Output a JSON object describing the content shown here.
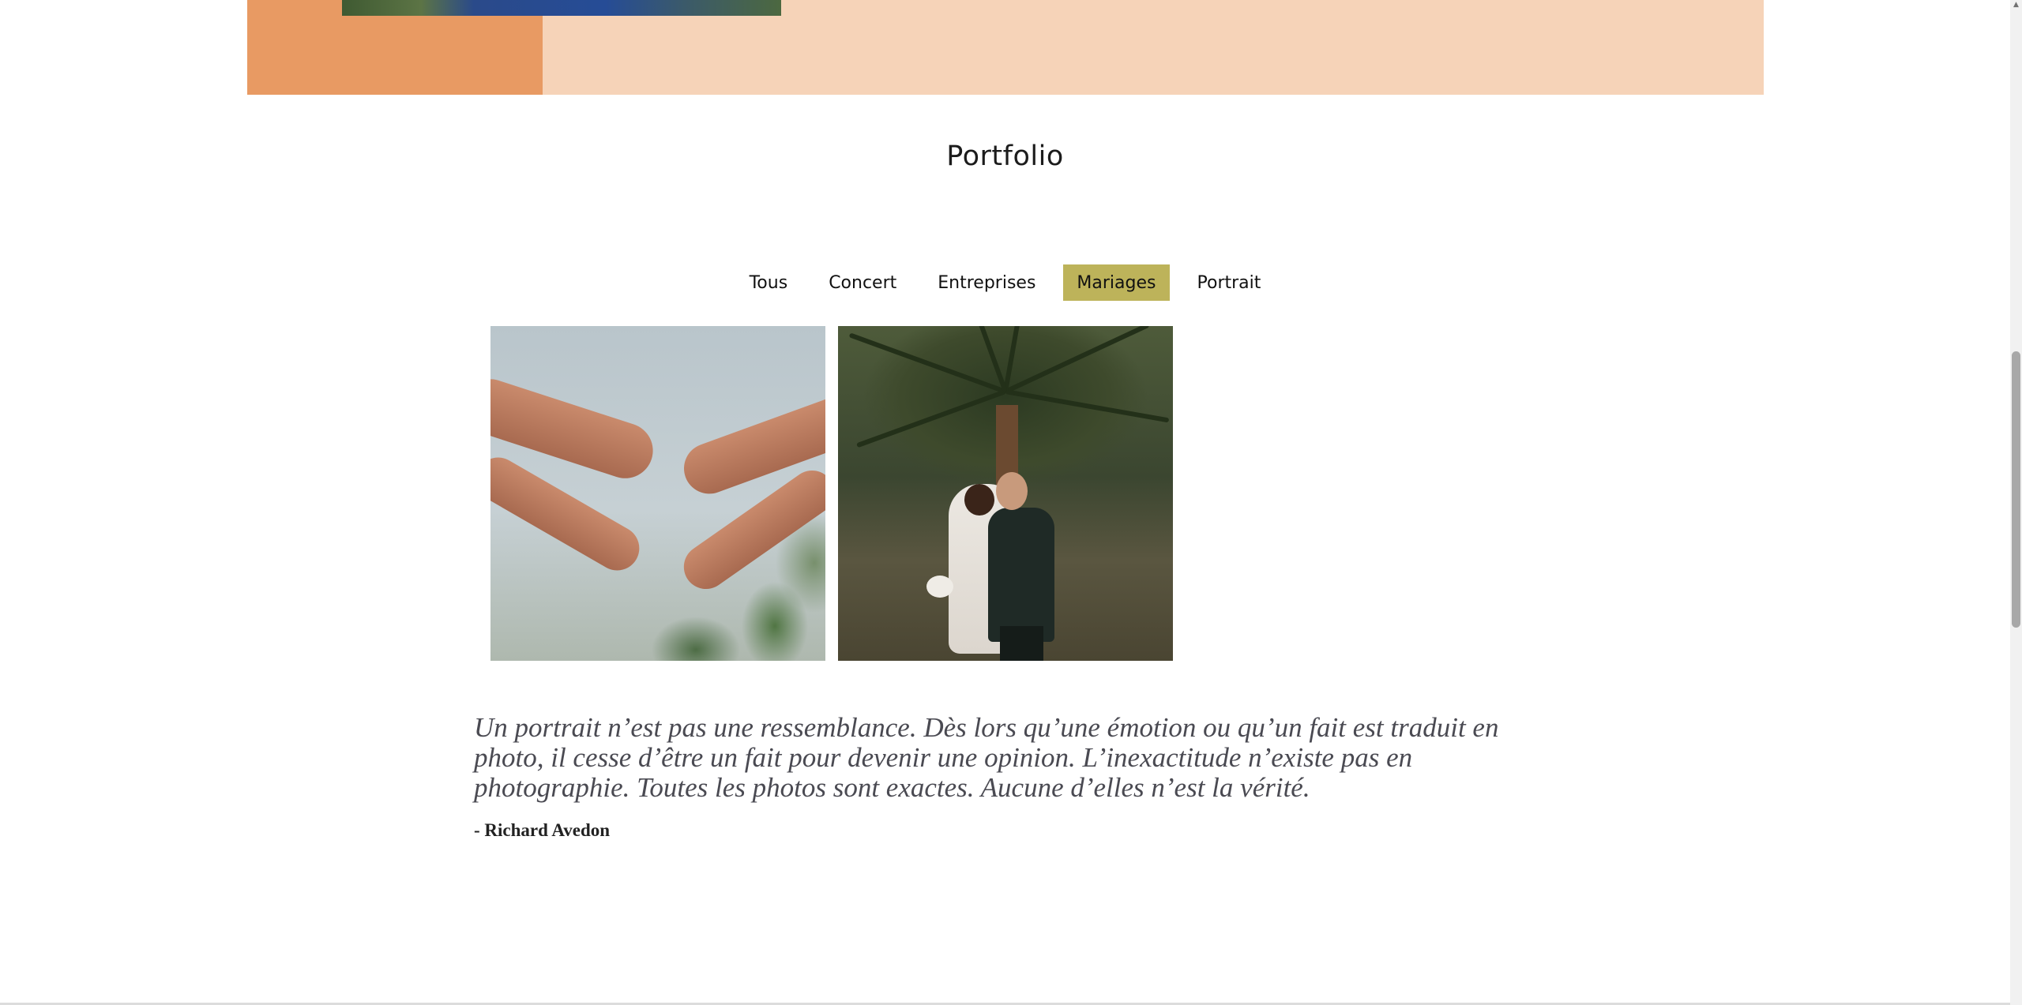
{
  "portfolio": {
    "title": "Portfolio",
    "filters": [
      {
        "label": "Tous",
        "active": false
      },
      {
        "label": "Concert",
        "active": false
      },
      {
        "label": "Entreprises",
        "active": false
      },
      {
        "label": "Mariages",
        "active": true
      },
      {
        "label": "Portrait",
        "active": false
      }
    ],
    "images": [
      {
        "subject": "hands-reaching"
      },
      {
        "subject": "wedding-couple-palm-tree"
      }
    ]
  },
  "quote": {
    "text": "Un portrait n’est pas une ressemblance. Dès lors qu’une émotion ou qu’un fait est traduit en photo, il cesse d’être un fait pour devenir une opinion. L’inexactitude n’existe pas en photographie. Toutes les photos sont exactes. Aucune d’elles n’est la vérité.",
    "author": "- Richard Avedon"
  },
  "colors": {
    "accent_active": "#bdb35a",
    "band_light": "#f6d3b8",
    "band_dark": "#e89a63"
  }
}
